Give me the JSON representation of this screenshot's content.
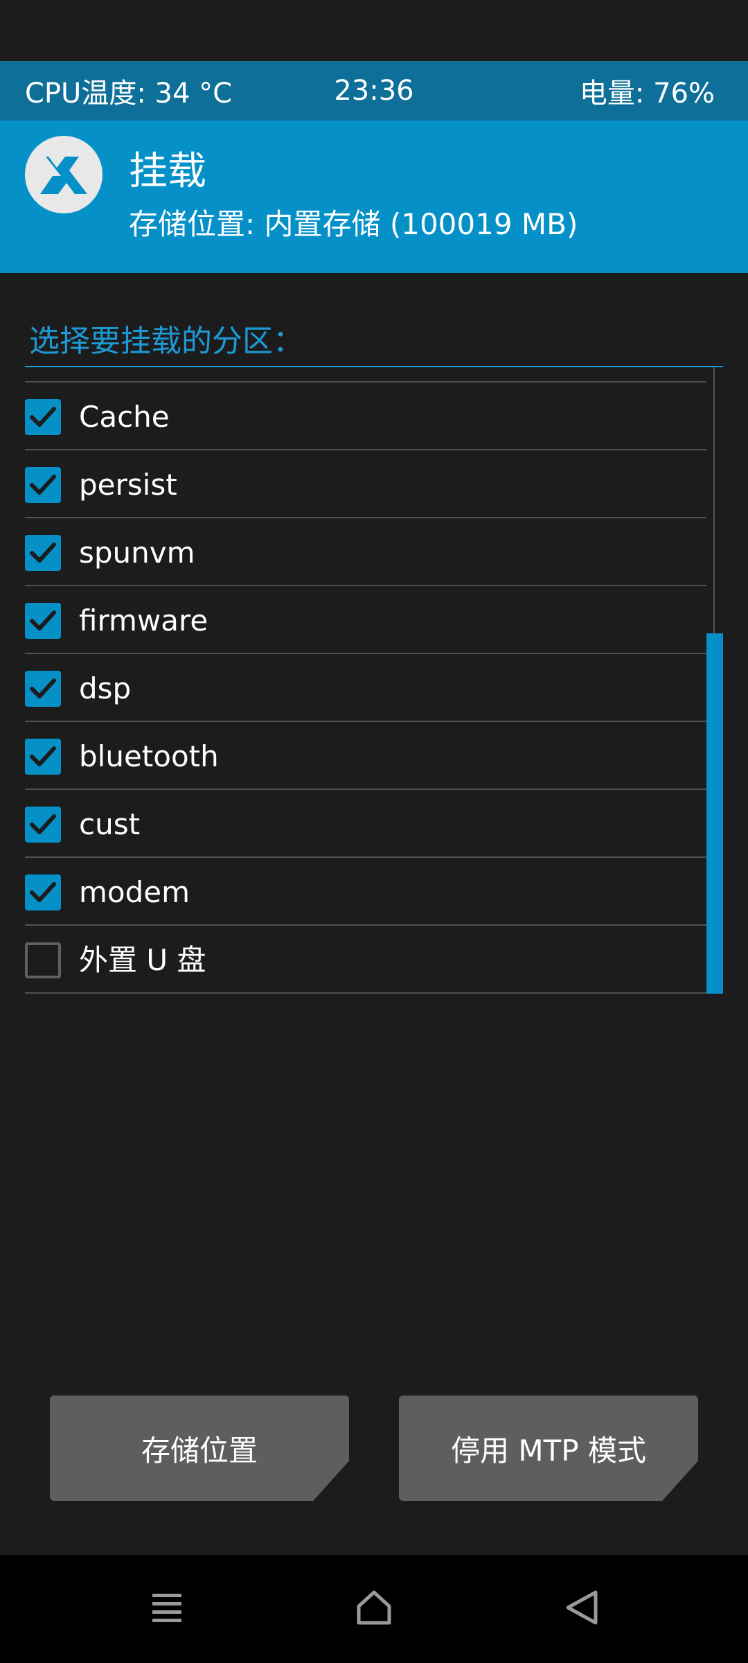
{
  "status": {
    "cpu_temp": "CPU温度: 34 °C",
    "time": "23:36",
    "battery": "电量: 76%"
  },
  "header": {
    "title": "挂载",
    "subtitle": "存储位置: 内置存储 (100019 MB)",
    "logo_icon": "twrp-logo-icon"
  },
  "prompt": "选择要挂载的分区：",
  "partitions": [
    {
      "label": "Cache",
      "checked": true
    },
    {
      "label": "persist",
      "checked": true
    },
    {
      "label": "spunvm",
      "checked": true
    },
    {
      "label": "firmware",
      "checked": true
    },
    {
      "label": "dsp",
      "checked": true
    },
    {
      "label": "bluetooth",
      "checked": true
    },
    {
      "label": "cust",
      "checked": true
    },
    {
      "label": "modem",
      "checked": true
    },
    {
      "label": "外置 U 盘",
      "checked": false
    }
  ],
  "buttons": {
    "storage": "存储位置",
    "mtp": "停用 MTP 模式"
  },
  "colors": {
    "accent": "#0591c8",
    "status_bar": "#0e6f99",
    "background": "#1c1c1c",
    "button": "#5e5e5e"
  },
  "nav_icons": [
    "menu-icon",
    "home-icon",
    "back-icon"
  ]
}
